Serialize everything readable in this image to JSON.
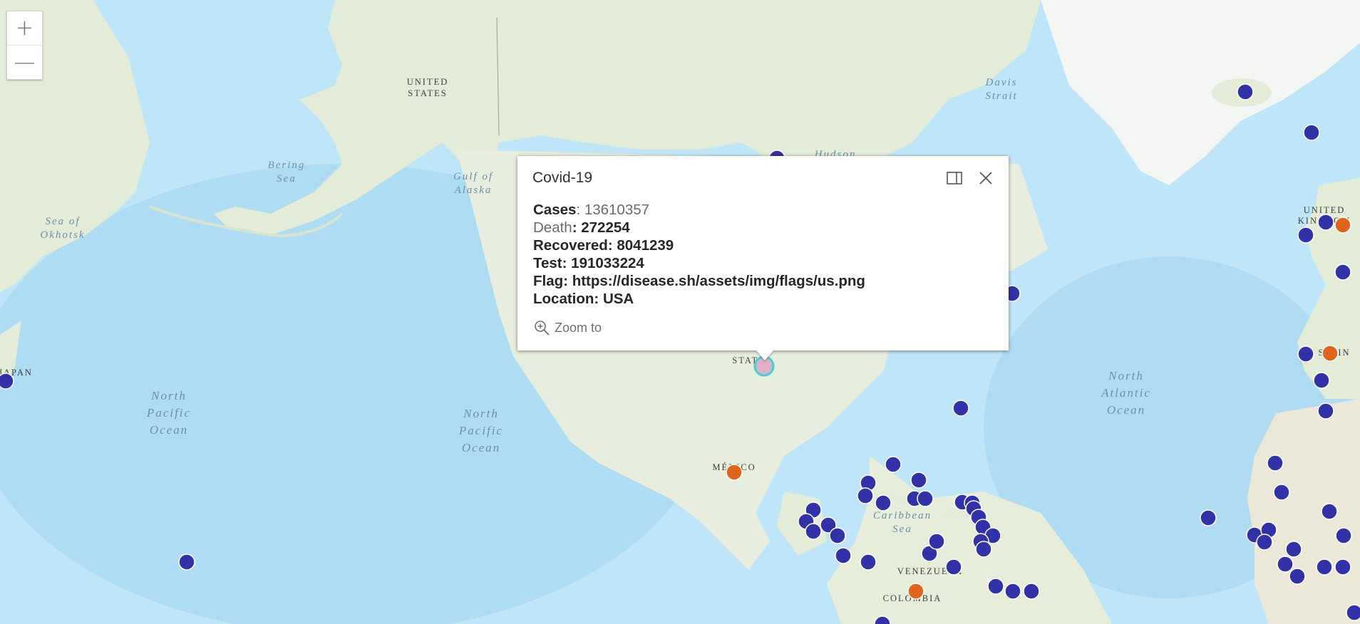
{
  "popup": {
    "title": "Covid-19",
    "fields": [
      {
        "key": "Cases",
        "sep": ": ",
        "value": "13610357",
        "style": "key-bold"
      },
      {
        "key": "Death",
        "sep": ": ",
        "value": "272254",
        "style": "value-bold"
      },
      {
        "key": "Recovered",
        "sep": ": ",
        "value": "8041239",
        "style": "all-bold"
      },
      {
        "key": "Test",
        "sep": ": ",
        "value": "191033224",
        "style": "all-bold"
      },
      {
        "key": "Flag",
        "sep": ": ",
        "value": "https://disease.sh/assets/img/flags/us.png",
        "style": "all-bold"
      },
      {
        "key": "Location",
        "sep": ": ",
        "value": "USA",
        "style": "all-bold"
      }
    ],
    "zoom_to_label": "Zoom to",
    "dock_icon": "dock-icon",
    "close_icon": "close-icon"
  },
  "zoom_controls": {
    "zoom_in": "+",
    "zoom_out": "—"
  },
  "map_labels": {
    "bering_sea": [
      "Bering",
      "Sea"
    ],
    "gulf_alaska": [
      "Gulf of",
      "Alaska"
    ],
    "sea_okhotsk": [
      "Sea of",
      "Okhotsk"
    ],
    "davis_strait": [
      "Davis",
      "Strait"
    ],
    "hudson": "Hudson",
    "north_pacific_1": [
      "North",
      "Pacific",
      "Ocean"
    ],
    "north_pacific_2": [
      "North",
      "Pacific",
      "Ocean"
    ],
    "north_atlantic": [
      "North",
      "Atlantic",
      "Ocean"
    ],
    "caribbean": [
      "Caribbean",
      "Sea"
    ],
    "united_states_top": [
      "UNITED",
      "STATES"
    ],
    "states_partial": "STATES",
    "mexico": "MÉXICO",
    "venezuela": "VENEZUELA",
    "colombia": "COLOMBIA",
    "japan": "JAPAN",
    "united_kingdom": [
      "UNITED",
      "KINGDOM"
    ],
    "spain": "SPAIN"
  },
  "colors": {
    "ocean": "#b9e3f7",
    "land": "#e6eedd",
    "point_blue": "#3131a8",
    "point_orange": "#e0641d",
    "selected": "#3ed1d8"
  }
}
